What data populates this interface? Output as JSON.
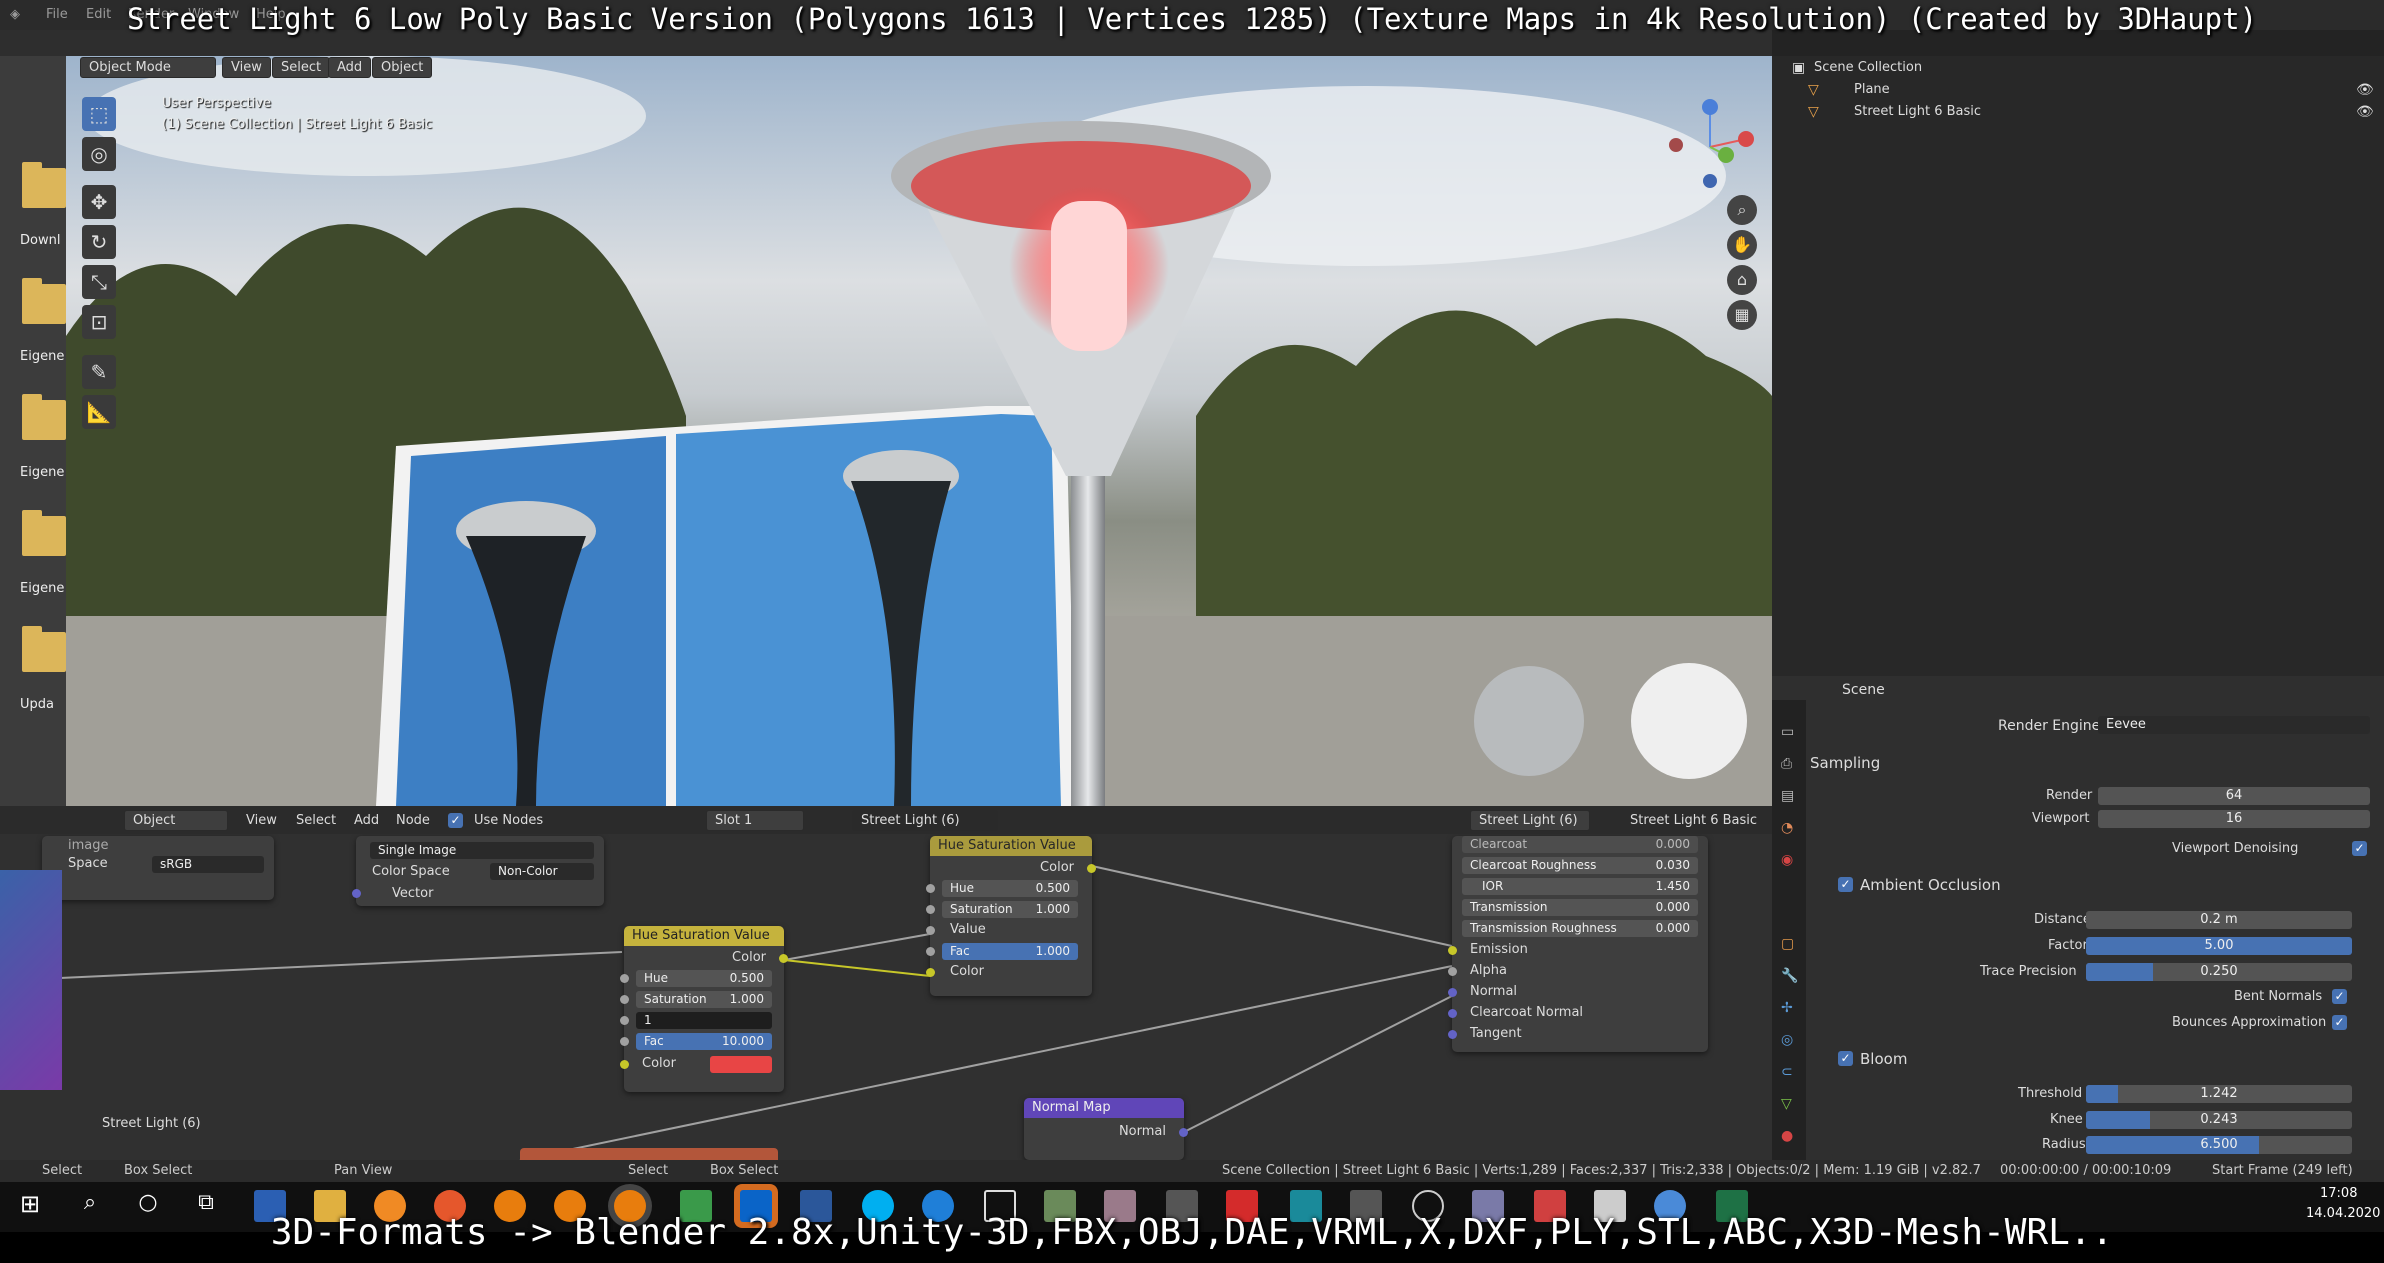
{
  "caption_top": "Street Light 6 Low Poly Basic Version (Polygons 1613 | Vertices 1285) (Texture Maps in 4k Resolution) (Created by 3DHaupt)",
  "caption_bottom": "3D-Formats -> Blender 2.8x,Unity-3D,FBX,OBJ,DAE,VRML,X,DXF,PLY,STL,ABC,X3D-Mesh-WRL..",
  "menu": [
    "File",
    "Edit",
    "Render",
    "Window",
    "Help"
  ],
  "desktop": [
    "Downl",
    "Eigene I",
    "Eigene I",
    "Eigene V",
    "Upda"
  ],
  "viewport": {
    "mode": "Object Mode",
    "menus": [
      "View",
      "Select",
      "Add",
      "Object"
    ],
    "overlay_line1": "User Perspective",
    "overlay_line2": "(1) Scene Collection | Street Light 6 Basic"
  },
  "outliner": {
    "root": "Scene Collection",
    "items": [
      "Plane",
      "Street Light 6 Basic"
    ]
  },
  "props": {
    "context": "Scene",
    "render_engine_label": "Render Engine",
    "render_engine": "Eevee",
    "sampling": {
      "title": "Sampling",
      "render_label": "Render",
      "render": "64",
      "viewport_label": "Viewport",
      "viewport": "16",
      "denoise": "Viewport Denoising"
    },
    "ao": {
      "title": "Ambient Occlusion",
      "distance_label": "Distance",
      "distance": "0.2 m",
      "factor_label": "Factor",
      "factor": "5.00",
      "trace_label": "Trace Precision",
      "trace": "0.250",
      "bent": "Bent Normals",
      "bounces": "Bounces Approximation"
    },
    "bloom": {
      "title": "Bloom",
      "threshold_label": "Threshold",
      "threshold": "1.242",
      "threshold_fill": 0.12,
      "knee_label": "Knee",
      "knee": "0.243",
      "knee_fill": 0.24,
      "radius_label": "Radius",
      "radius": "6.500",
      "radius_fill": 0.65
    }
  },
  "node_header": {
    "editor": "Object",
    "menus": [
      "View",
      "Select",
      "Add",
      "Node"
    ],
    "use_nodes": "Use Nodes",
    "slot": "Slot 1",
    "material": "Street Light (6)",
    "object_mat": "Street Light (6)",
    "object": "Street Light 6 Basic"
  },
  "nodes": {
    "image": {
      "partial": "image",
      "space_label": "Space",
      "space": "sRGB"
    },
    "tex": {
      "single": "Single Image",
      "cs_label": "Color Space",
      "cs": "Non-Color",
      "vector": "Vector"
    },
    "hsv1": {
      "title": "Hue Saturation Value",
      "color_out": "Color",
      "hue_label": "Hue",
      "hue": "0.500",
      "sat_label": "Saturation",
      "sat": "1.000",
      "value_edit": "1",
      "fac_label": "Fac",
      "fac": "10.000",
      "color_in": "Color"
    },
    "hsv2": {
      "title": "Hue Saturation Value",
      "color_out": "Color",
      "hue_label": "Hue",
      "hue": "0.500",
      "sat_label": "Saturation",
      "sat": "1.000",
      "value": "Value",
      "fac_label": "Fac",
      "fac": "1.000",
      "color_in": "Color"
    },
    "bsdf": {
      "clearcoat_label": "Clearcoat",
      "clearcoat": "0.000",
      "ccr_label": "Clearcoat Roughness",
      "ccr": "0.030",
      "ior_label": "IOR",
      "ior": "1.450",
      "trans_label": "Transmission",
      "trans": "0.000",
      "trr_label": "Transmission Roughness",
      "trr": "0.000",
      "emission": "Emission",
      "alpha": "Alpha",
      "normal": "Normal",
      "ccn": "Clearcoat Normal",
      "tangent": "Tangent"
    },
    "normalmap": {
      "title": "Normal Map",
      "out": "Normal"
    },
    "frame_label": "Street Light (6)"
  },
  "status": {
    "select": "Select",
    "box": "Box Select",
    "pan": "Pan View",
    "select2": "Select",
    "box2": "Box Select",
    "info": "Scene Collection | Street Light 6 Basic | Verts:1,289 | Faces:2,337 | Tris:2,338 | Objects:0/2 | Mem: 1.19 GiB | v2.82.7",
    "time": "00:00:00:00 / 00:00:10:09",
    "frame": "Start Frame (249 left)"
  },
  "clock": {
    "time": "17:08",
    "date": "14.04.2020"
  },
  "colors": {
    "accent": "#4772b3",
    "node_hsv": "#c5b33d",
    "node_normal": "#6046b8",
    "fac_red": "#e84545"
  }
}
